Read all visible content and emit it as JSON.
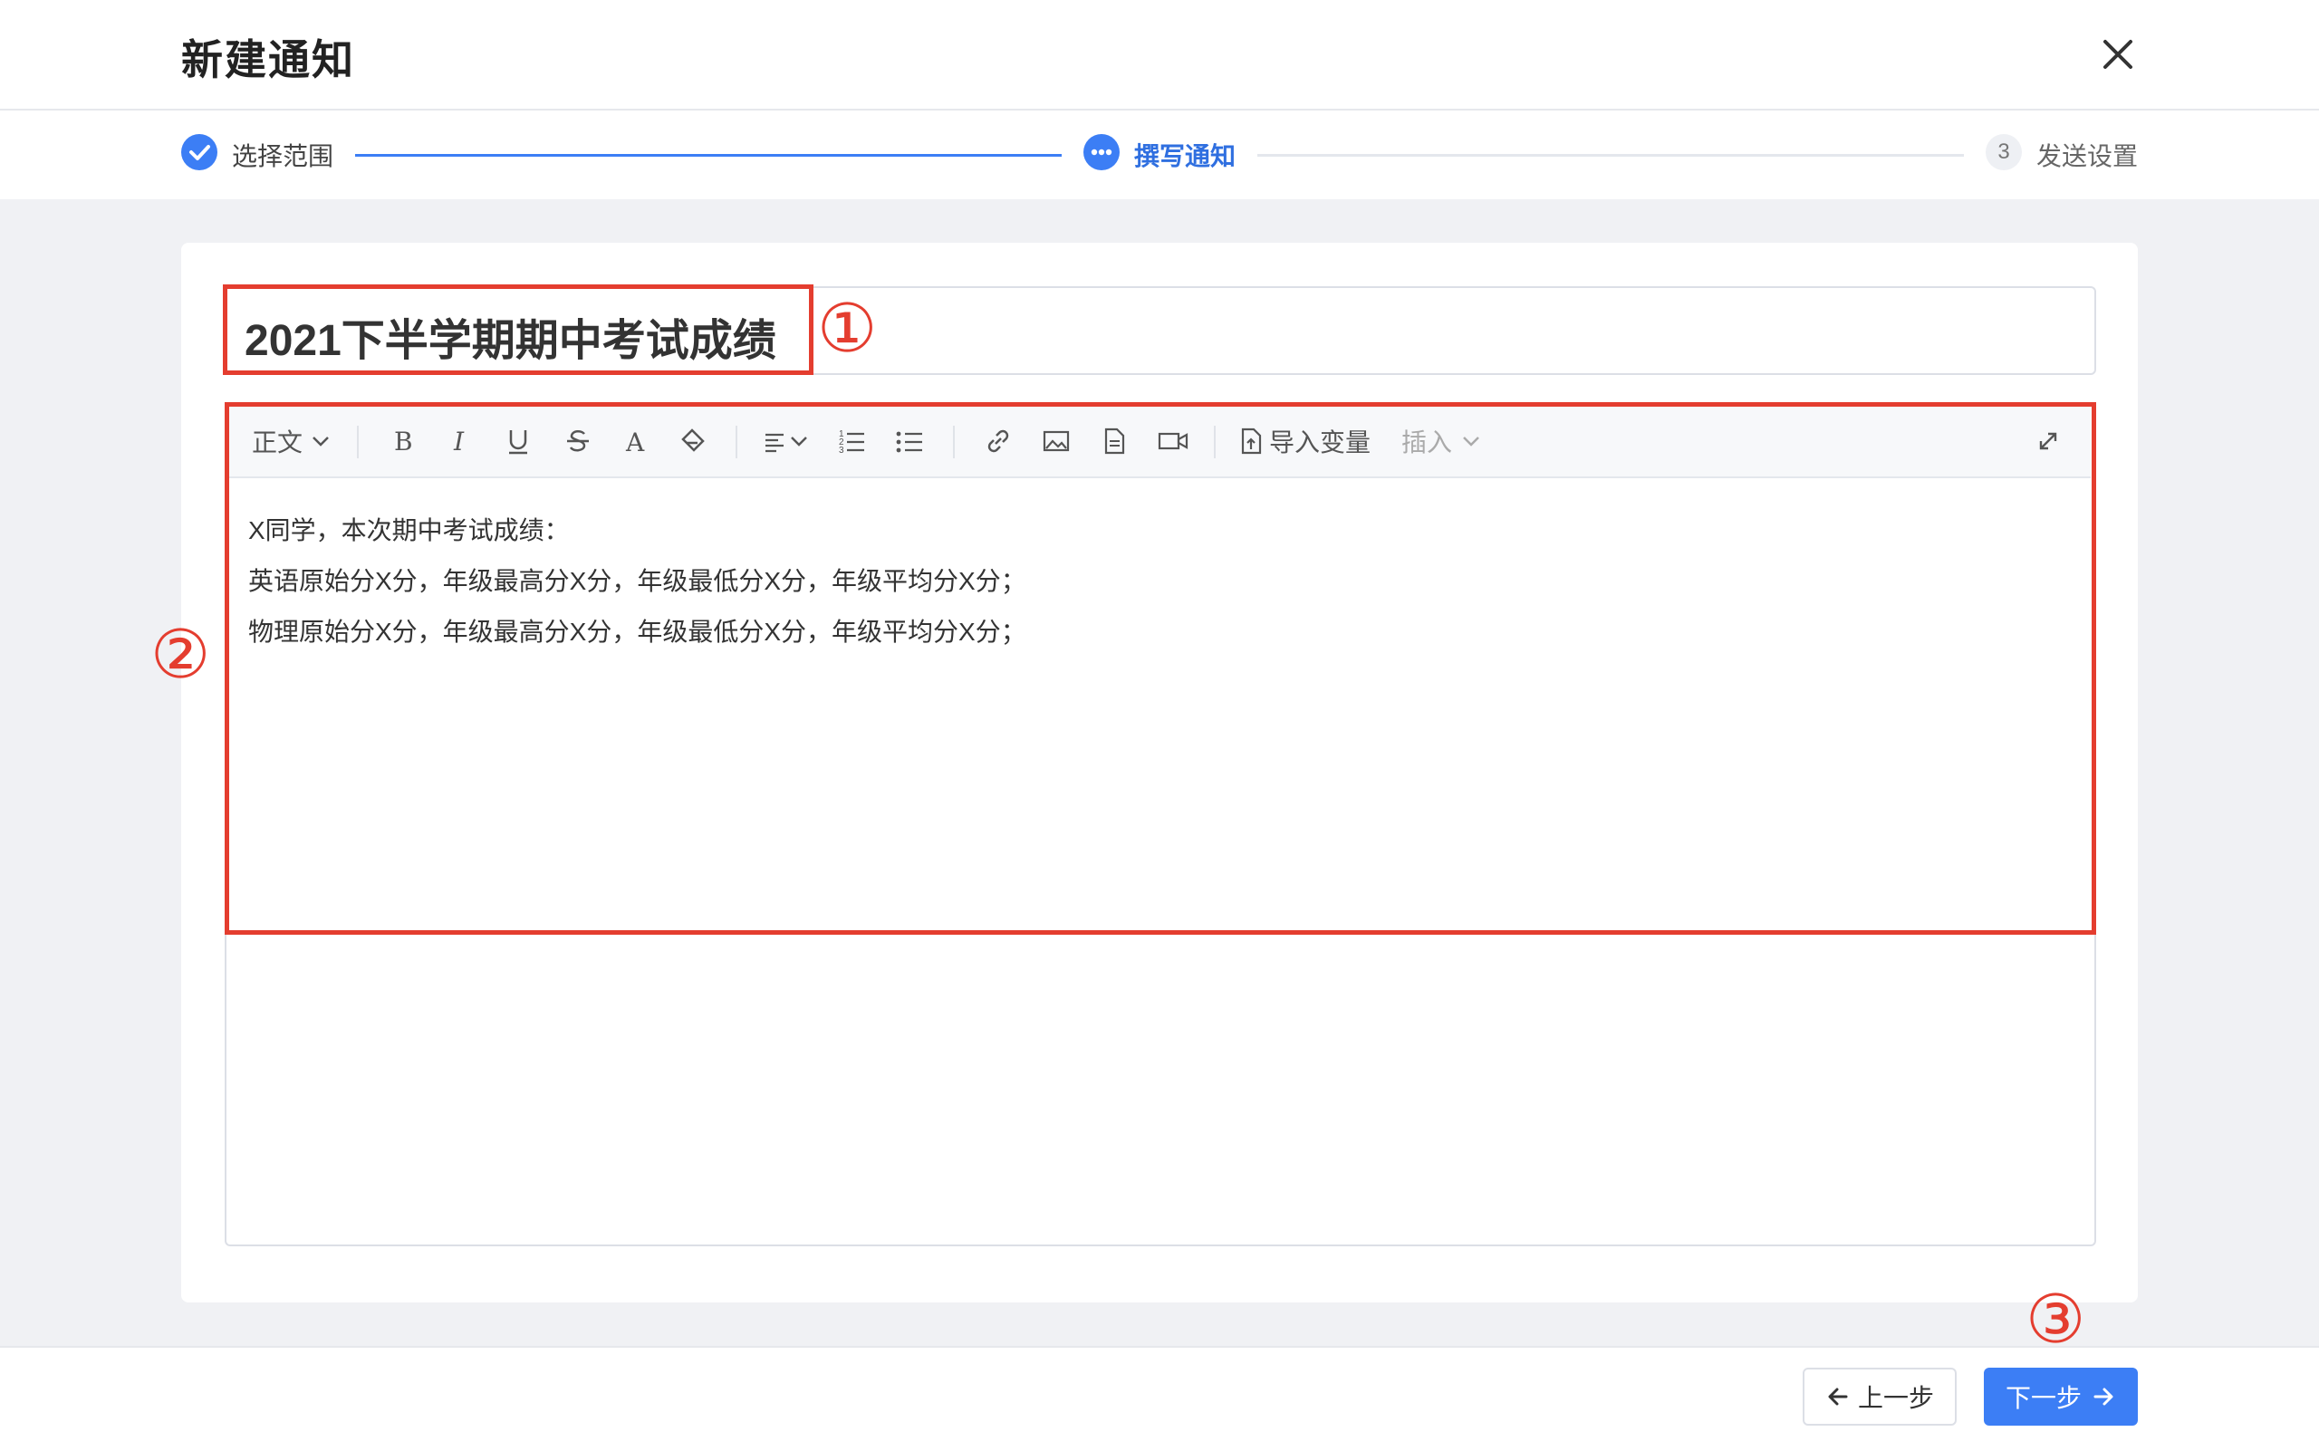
{
  "dialog": {
    "title": "新建通知",
    "close_icon": "close-icon"
  },
  "steps": [
    {
      "label": "选择范围",
      "status": "done"
    },
    {
      "label": "撰写通知",
      "status": "active"
    },
    {
      "label": "发送设置",
      "status": "pending",
      "number": "3"
    }
  ],
  "colors": {
    "accent": "#3c7ef5",
    "annotation": "#e43d2f"
  },
  "form": {
    "title_value": "2021下半学期期中考试成绩",
    "toolbar": {
      "paragraph_format": "正文",
      "import_variable": "导入变量",
      "insert": "插入",
      "icons": [
        "bold-icon",
        "italic-icon",
        "underline-icon",
        "strikethrough-icon",
        "font-color-icon",
        "clear-format-icon",
        "align-icon",
        "ordered-list-icon",
        "bullet-list-icon",
        "link-icon",
        "image-icon",
        "file-icon",
        "video-icon",
        "import-icon",
        "fullscreen-icon"
      ]
    },
    "content_lines": [
      "X同学，本次期中考试成绩：",
      "英语原始分X分，年级最高分X分，年级最低分X分，年级平均分X分；",
      "物理原始分X分，年级最高分X分，年级最低分X分，年级平均分X分；"
    ]
  },
  "annotations": [
    "①",
    "②",
    "③"
  ],
  "footer": {
    "prev_label": "上一步",
    "next_label": "下一步"
  }
}
